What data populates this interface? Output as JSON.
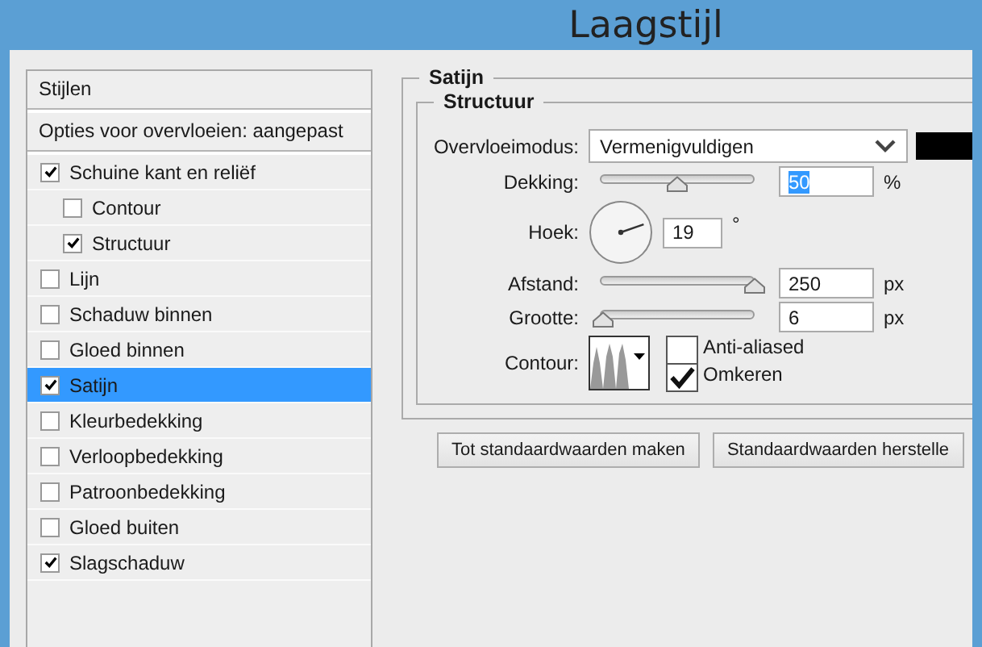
{
  "window": {
    "title": "Laagstijl"
  },
  "styles_list": {
    "headers": [
      "Stijlen",
      "Opties voor overvloeien: aangepast"
    ],
    "items": [
      {
        "label": "Schuine kant en reliëf",
        "checked": true,
        "selected": false,
        "children": [
          {
            "label": "Contour",
            "checked": false,
            "selected": false
          },
          {
            "label": "Structuur",
            "checked": true,
            "selected": false
          }
        ]
      },
      {
        "label": "Lijn",
        "checked": false,
        "selected": false
      },
      {
        "label": "Schaduw binnen",
        "checked": false,
        "selected": false
      },
      {
        "label": "Gloed binnen",
        "checked": false,
        "selected": false
      },
      {
        "label": "Satijn",
        "checked": true,
        "selected": true
      },
      {
        "label": "Kleurbedekking",
        "checked": false,
        "selected": false
      },
      {
        "label": "Verloopbedekking",
        "checked": false,
        "selected": false
      },
      {
        "label": "Patroonbedekking",
        "checked": false,
        "selected": false
      },
      {
        "label": "Gloed buiten",
        "checked": false,
        "selected": false
      },
      {
        "label": "Slagschaduw",
        "checked": true,
        "selected": false
      }
    ]
  },
  "panel": {
    "title": "Satijn",
    "group_title": "Structuur",
    "blend_mode": {
      "label": "Overvloeimodus:",
      "value": "Vermenigvuldigen",
      "color": "#000000"
    },
    "opacity": {
      "label": "Dekking:",
      "level": 0.5,
      "value": "50",
      "unit": "%",
      "text_selected": true
    },
    "angle": {
      "label": "Hoek:",
      "value": "19",
      "unit": "°"
    },
    "distance": {
      "label": "Afstand:",
      "level": 1,
      "value": "250",
      "unit": "px"
    },
    "size": {
      "label": "Grootte:",
      "level": 0.02,
      "value": "6",
      "unit": "px"
    },
    "contour": {
      "label": "Contour:"
    },
    "checkboxes": [
      {
        "label": "Anti-aliased",
        "checked": false
      },
      {
        "label": "Omkeren",
        "checked": true
      }
    ]
  },
  "buttons": [
    "Tot standaardwaarden maken",
    "Standaardwaarden herstelle"
  ]
}
